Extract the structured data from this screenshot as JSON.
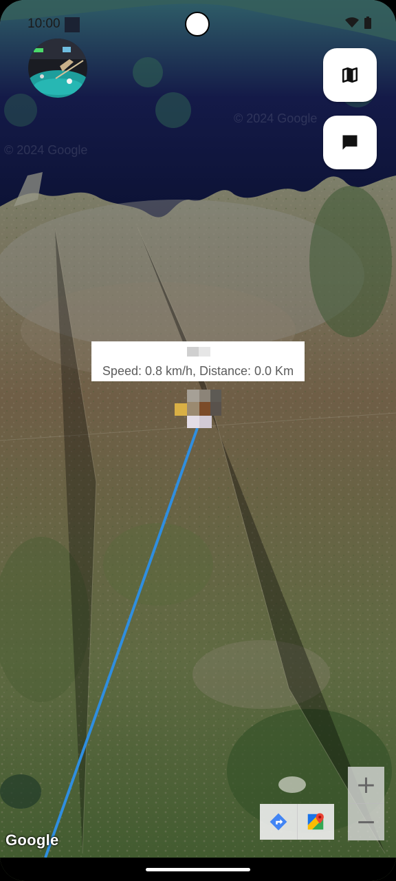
{
  "status_bar": {
    "time": "10:00"
  },
  "header": {
    "avatar_icon": "profile-photo-billiards",
    "map_type_button_icon": "map-icon",
    "chat_button_icon": "chat-icon"
  },
  "map": {
    "watermark_1": "© 2024 Google",
    "watermark_2": "© 2024 Google",
    "google_logo": "Google",
    "route_color": "#2f8ee0"
  },
  "info_window": {
    "title": "",
    "snippet": "Speed: 0.8 km/h, Distance: 0.0 Km"
  },
  "map_toolbar": {
    "directions_icon": "directions-icon",
    "open_maps_icon": "google-maps-icon"
  },
  "zoom": {
    "zoom_in": "+",
    "zoom_out": "−"
  }
}
